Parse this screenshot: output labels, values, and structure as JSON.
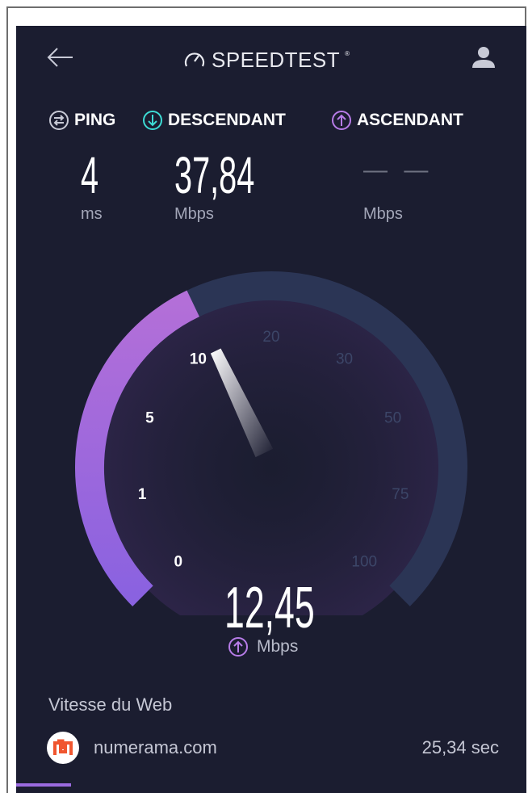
{
  "header": {
    "back_icon": "arrow-left-icon",
    "logo_text": "SPEEDTEST",
    "logo_tm": "®",
    "user_icon": "user-icon"
  },
  "metrics": {
    "ping": {
      "label": "PING",
      "value": "4",
      "unit": "ms",
      "icon": "ping-icon"
    },
    "download": {
      "label": "DESCENDANT",
      "value": "37,84",
      "unit": "Mbps",
      "icon": "download-arrow-icon",
      "color": "#3ddbd4"
    },
    "upload": {
      "label": "ASCENDANT",
      "value": "— —",
      "unit": "Mbps",
      "icon": "upload-arrow-icon",
      "color": "#b77ce8"
    }
  },
  "gauge": {
    "ticks": [
      "0",
      "1",
      "5",
      "10",
      "20",
      "30",
      "50",
      "75",
      "100"
    ],
    "current_value": 12.45,
    "current_label": "12,45",
    "unit": "Mbps",
    "fill_color": "#a66fe0",
    "track_color": "#2b3555"
  },
  "web": {
    "title": "Vitesse du Web",
    "site": "numerama.com",
    "time": "25,34 sec",
    "logo_icon": "numerama-logo-icon",
    "logo_color": "#f0562f"
  },
  "colors": {
    "background": "#1b1d30",
    "text": "#ffffff",
    "muted": "#a3a6b8"
  }
}
